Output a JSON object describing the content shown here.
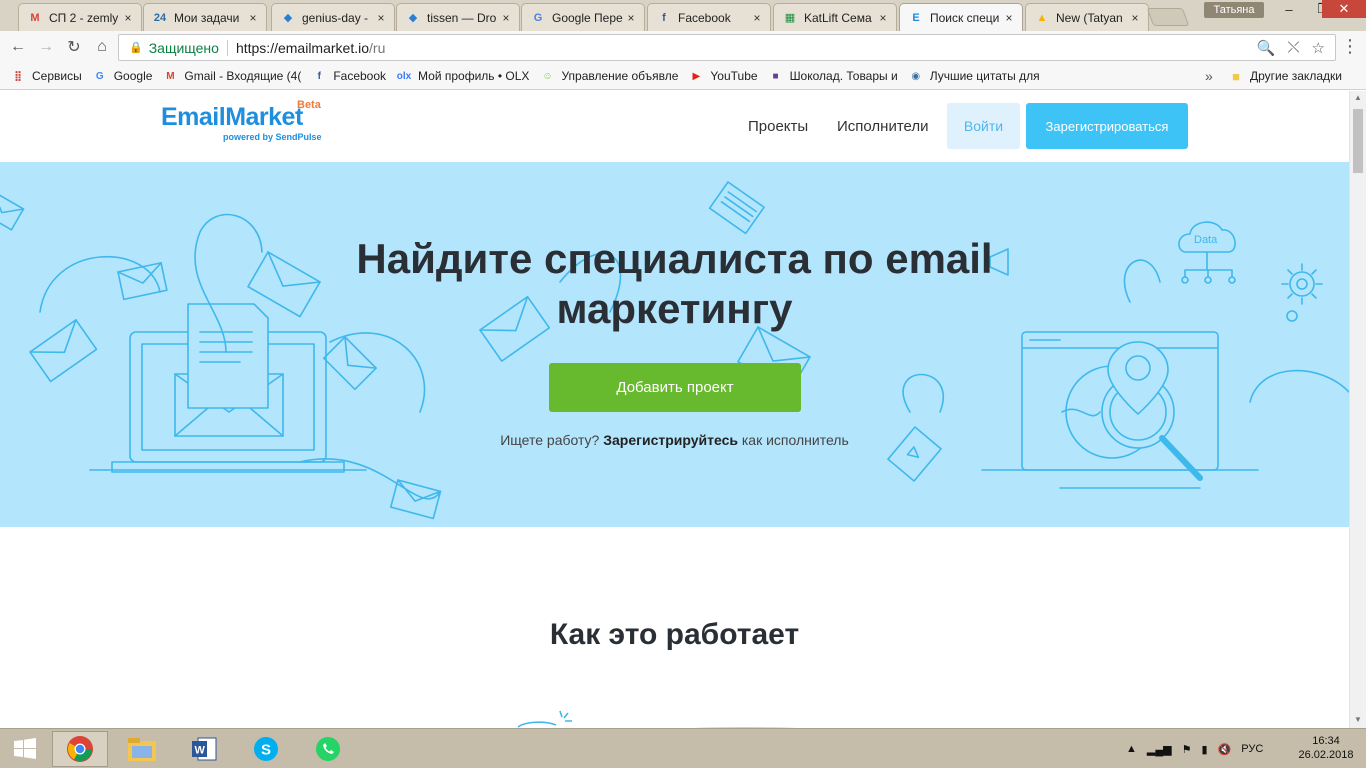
{
  "browser": {
    "tabs": [
      {
        "title": "СП 2 - zemly",
        "icon": "gmail-icon",
        "fav_text": "M",
        "fav_color": "#d44638"
      },
      {
        "title": "Мои задачи",
        "icon": "bitrix24-icon",
        "fav_text": "24",
        "fav_color": "#2e6da4"
      },
      {
        "title": "genius-day -",
        "icon": "dropbox-icon",
        "fav_text": "◆",
        "fav_color": "#2a7fd4"
      },
      {
        "title": "tissen — Dro",
        "icon": "dropbox-icon",
        "fav_text": "◆",
        "fav_color": "#2a7fd4"
      },
      {
        "title": "Google Пере",
        "icon": "google-translate-icon",
        "fav_text": "G",
        "fav_color": "#4a7fe5"
      },
      {
        "title": "Facebook",
        "icon": "facebook-icon",
        "fav_text": "f",
        "fav_color": "#3b5998"
      },
      {
        "title": "KatLift Сема",
        "icon": "sheets-icon",
        "fav_text": "▦",
        "fav_color": "#1e8e3e"
      },
      {
        "title": "Поиск специ",
        "icon": "emailmarket-icon",
        "fav_text": "E",
        "fav_color": "#1e8ede",
        "active": true
      },
      {
        "title": "New (Tatyan",
        "icon": "google-drive-icon",
        "fav_text": "▲",
        "fav_color": "#f4b400"
      }
    ],
    "tab_close": "×",
    "user_name": "Татьяна",
    "window_controls": {
      "minimize": "–",
      "restore": "❐",
      "close": "✕"
    },
    "nav": {
      "back": "←",
      "forward": "→",
      "reload": "↻",
      "home": "⌂"
    },
    "omnibox": {
      "secure_label": "Защищено",
      "url_host": "https://emailmarket.io",
      "url_path": "/ru"
    },
    "omnibox_icons": {
      "zoom": "🔍",
      "extension": "⤬",
      "star": "☆"
    },
    "menu": "⋮",
    "bookmarks": [
      {
        "label": "Сервисы",
        "icon": "apps-icon",
        "glyph": "⣿",
        "color": "#d44638"
      },
      {
        "label": "Google",
        "icon": "google-icon",
        "glyph": "G",
        "color": "#4285f4"
      },
      {
        "label": "Gmail - Входящие (4(",
        "icon": "gmail-icon",
        "glyph": "M",
        "color": "#d44638"
      },
      {
        "label": "Facebook",
        "icon": "facebook-icon",
        "glyph": "f",
        "color": "#3b5998"
      },
      {
        "label": "Мой профиль • OLX",
        "icon": "olx-icon",
        "glyph": "olx",
        "color": "#3a77ff"
      },
      {
        "label": "Управление объявле",
        "icon": "smiley-icon",
        "glyph": "☺",
        "color": "#8bc34a"
      },
      {
        "label": "YouTube",
        "icon": "youtube-icon",
        "glyph": "▶",
        "color": "#e62117"
      },
      {
        "label": "Шоколад. Товары и",
        "icon": "shop-icon",
        "glyph": "■",
        "color": "#6a3d9a"
      },
      {
        "label": "Лучшие цитаты для",
        "icon": "globe-icon",
        "glyph": "◉",
        "color": "#3b6ea5"
      }
    ],
    "bookmarks_more": "»",
    "other_bookmarks": "Другие закладки"
  },
  "site": {
    "logo": {
      "word": "EmailMarket",
      "beta": "Beta",
      "powered": "powered by SendPulse"
    },
    "nav": {
      "projects": "Проекты",
      "freelancers": "Исполнители"
    },
    "login": "Войти",
    "register": "Зарегистрироваться",
    "hero": {
      "title_line1": "Найдите специалиста по email",
      "title_line2": "маркетингу",
      "cta": "Добавить проект",
      "note_prefix": "Ищете работу?",
      "note_link": "Зарегистрируйтесь",
      "note_suffix": "как исполнитель",
      "data_label": "Data"
    },
    "how_title": "Как это работает"
  },
  "taskbar": {
    "tray_lang": "РУС",
    "clock_time": "16:34",
    "clock_date": "26.02.2018"
  },
  "colors": {
    "brand_blue": "#1e8ede",
    "hero_bg": "#b3e5fc",
    "cta_green": "#67b92d",
    "register_blue": "#3ec3f7"
  }
}
